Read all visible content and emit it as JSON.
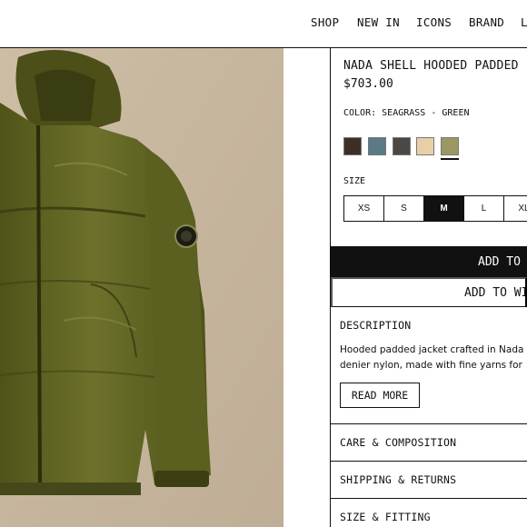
{
  "nav": {
    "items": [
      "SHOP",
      "NEW IN",
      "ICONS",
      "BRAND",
      "L"
    ]
  },
  "product": {
    "title": "NADA SHELL HOODED PADDED",
    "price": "$703.00",
    "color_label": "COLOR:",
    "color_value": "SEAGRASS - GREEN",
    "swatch_colors": [
      "#3d2f26",
      "#5a7a86",
      "#4a4745",
      "#e8cfa6",
      "#9a9863"
    ],
    "size_label": "SIZE",
    "sizes": [
      "XS",
      "S",
      "M",
      "L",
      "XL"
    ],
    "selected_size": "M",
    "add_to_bag": "ADD TO",
    "add_to_wishlist": "ADD TO WI"
  },
  "sections": {
    "description_title": "DESCRIPTION",
    "description_line1": "Hooded padded jacket crafted in Nada",
    "description_line2": "denier nylon, made with fine yarns for",
    "read_more": "READ MORE",
    "care": "CARE & COMPOSITION",
    "shipping": "SHIPPING & RETURNS",
    "fitting": "SIZE & FITTING"
  },
  "colors": {
    "image_background": "#c9b9a1",
    "jacket_green": "#5f6322",
    "ink": "#111111"
  }
}
